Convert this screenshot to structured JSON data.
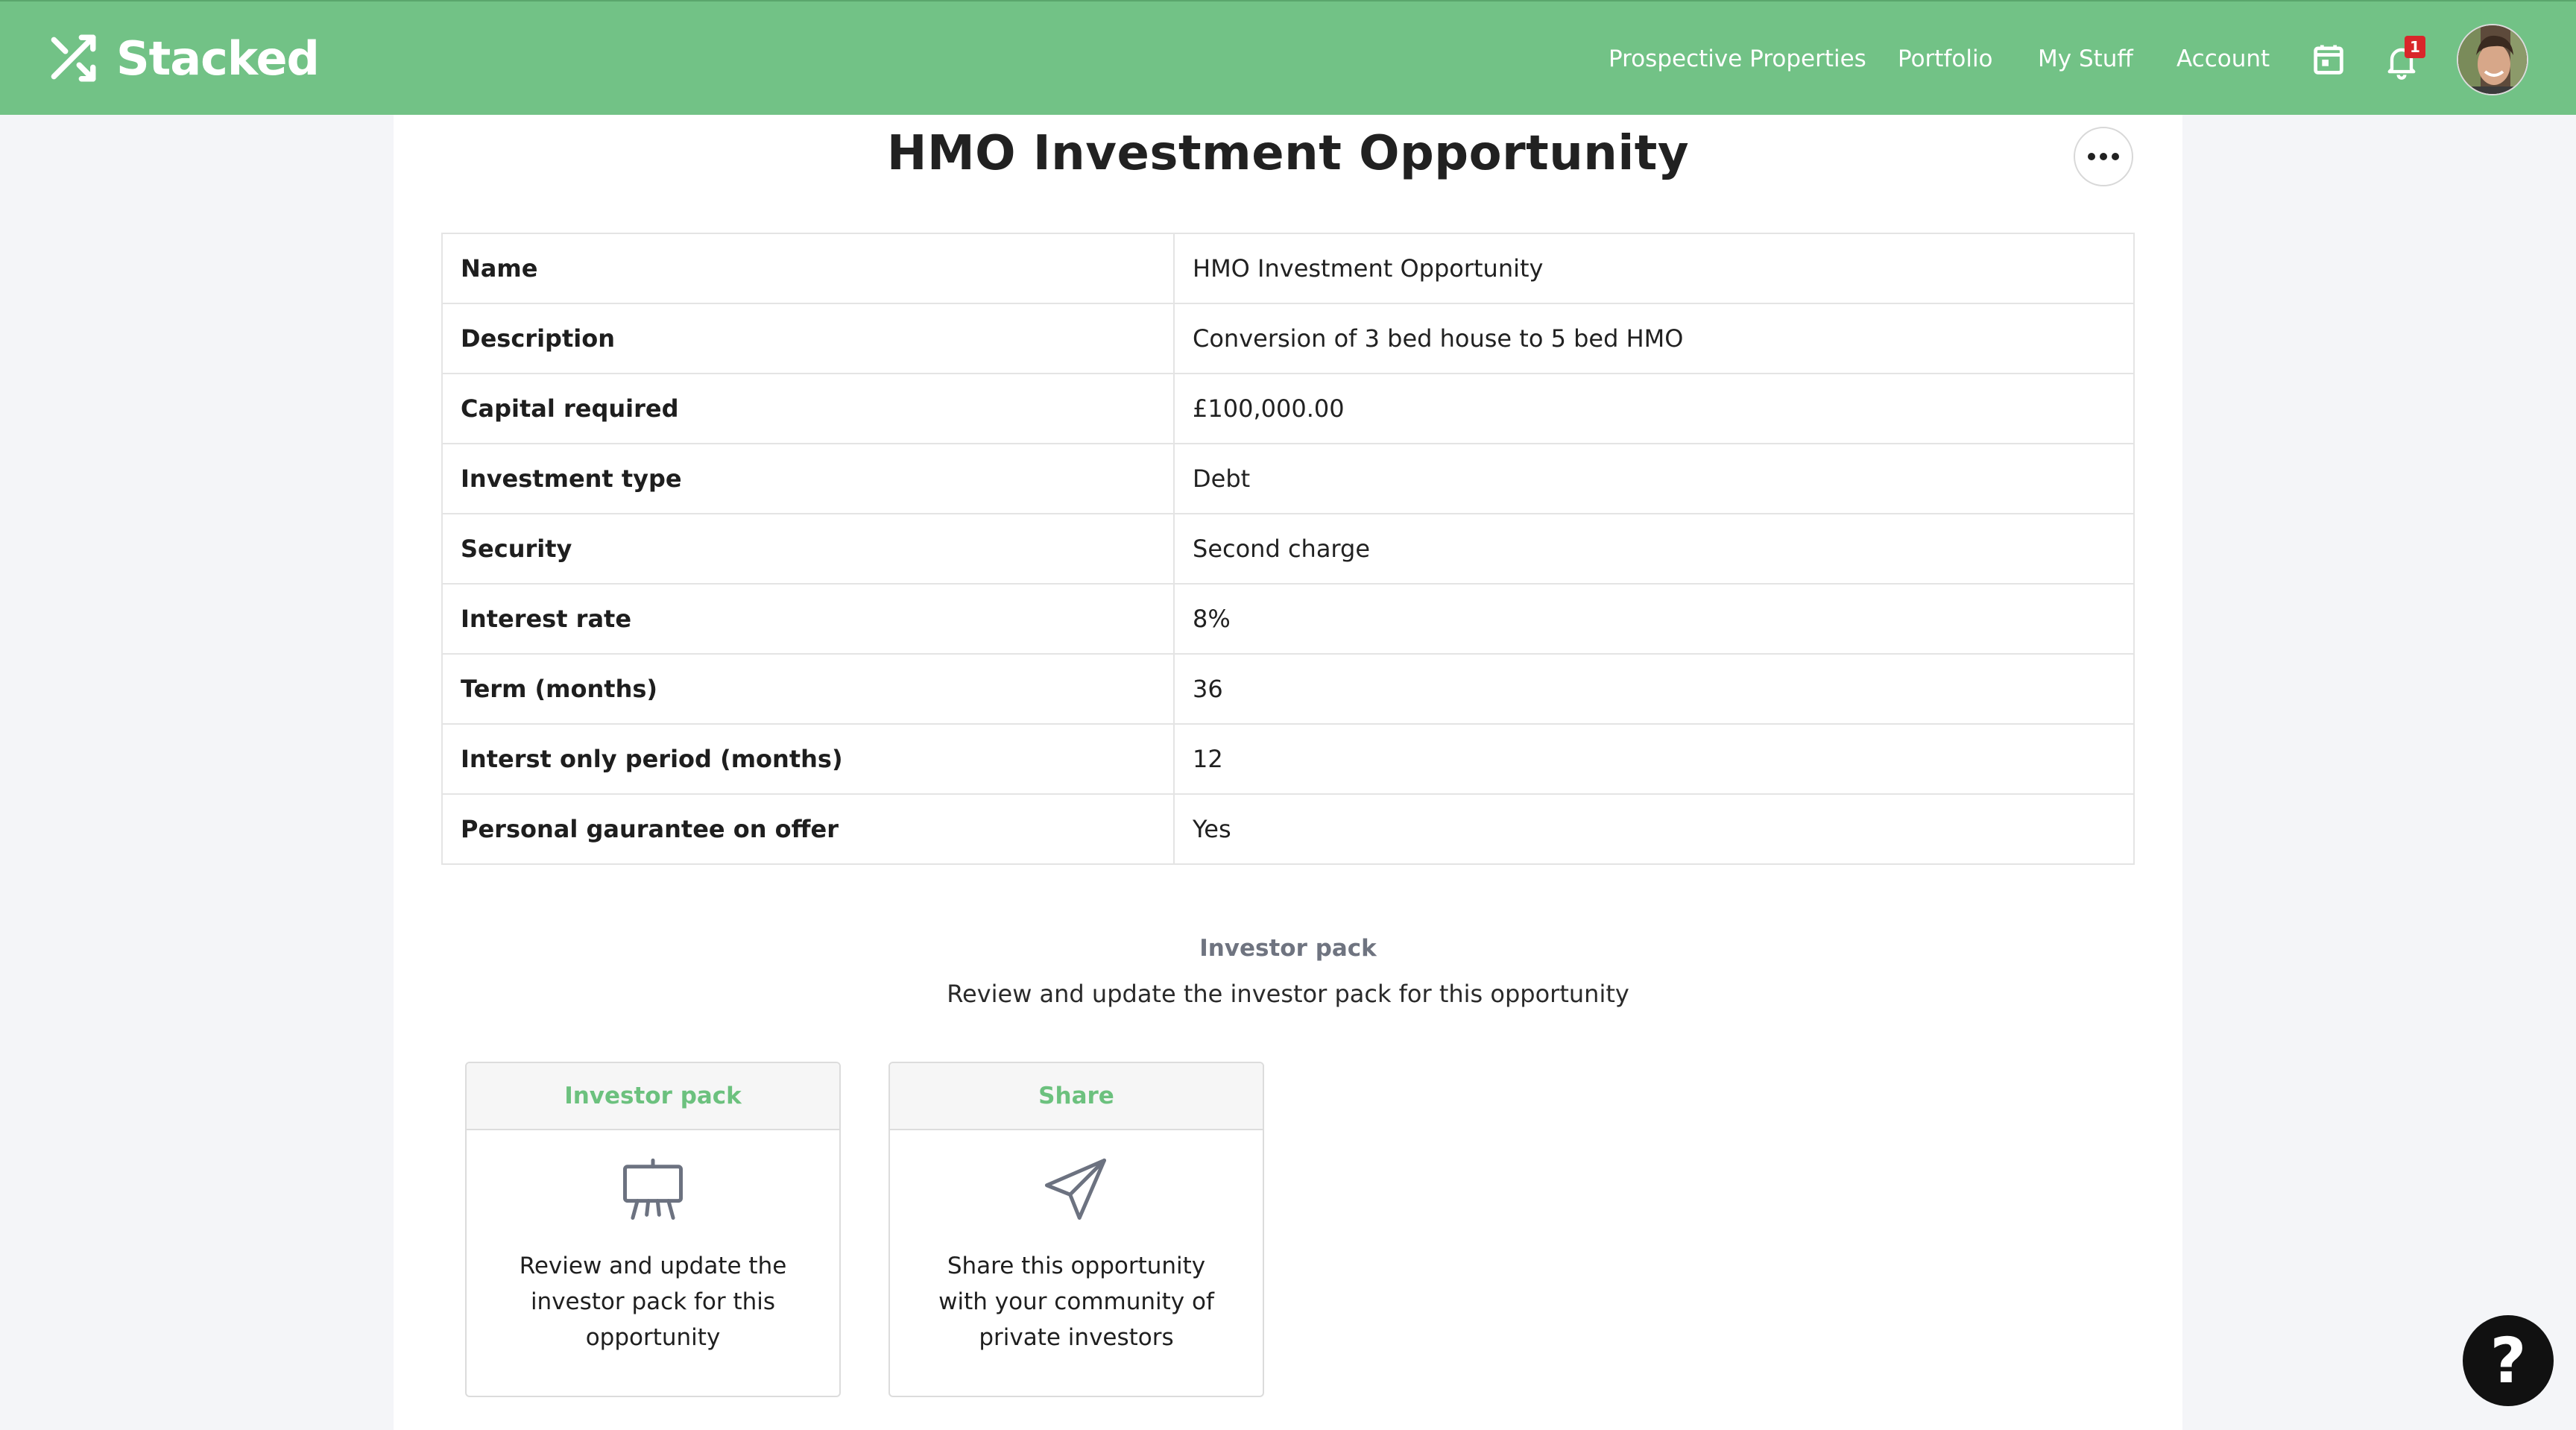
{
  "app": {
    "brand": "Stacked"
  },
  "nav": {
    "prospective": "Prospective Properties",
    "portfolio": "Portfolio",
    "mystuff": "My Stuff",
    "account": "Account",
    "notification_count": "1"
  },
  "page": {
    "title": "HMO Investment Opportunity"
  },
  "details": [
    {
      "label": "Name",
      "value": "HMO Investment Opportunity"
    },
    {
      "label": "Description",
      "value": "Conversion of 3 bed house to 5 bed HMO"
    },
    {
      "label": "Capital required",
      "value": "£100,000.00"
    },
    {
      "label": "Investment type",
      "value": "Debt"
    },
    {
      "label": "Security",
      "value": "Second charge"
    },
    {
      "label": "Interest rate",
      "value": "8%"
    },
    {
      "label": "Term (months)",
      "value": "36"
    },
    {
      "label": "Interst only period (months)",
      "value": "12"
    },
    {
      "label": "Personal gaurantee on offer",
      "value": "Yes"
    }
  ],
  "investor_section": {
    "title": "Investor pack",
    "subtitle": "Review and update the investor pack for this opportunity"
  },
  "cards": {
    "investor": {
      "title": "Investor pack",
      "text": "Review and update the investor pack for this opportunity",
      "icon": "presentation-easel-icon"
    },
    "share": {
      "title": "Share",
      "text": "Share this opportunity with your community of private investors",
      "icon": "paper-plane-icon"
    }
  },
  "help": {
    "label": "?"
  },
  "colors": {
    "brand_green": "#72c286",
    "card_title_green": "#6cc17e",
    "badge_red": "#d9262a"
  }
}
